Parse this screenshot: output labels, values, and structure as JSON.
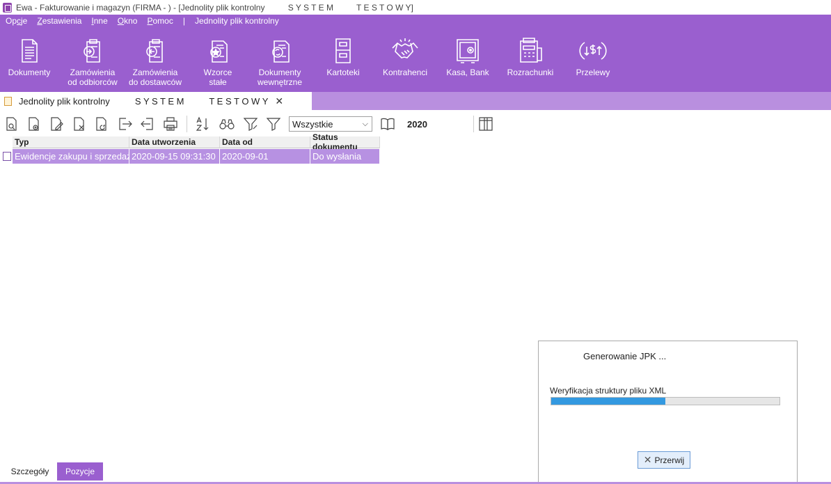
{
  "window": {
    "title": "Ewa - Fakturowanie i magazyn (FIRMA - ) - [Jednolity plik kontrolny          S Y S T E M          T E S T O W Y]"
  },
  "menu": {
    "items": [
      {
        "pre": "Op",
        "u": "c",
        "post": "je"
      },
      {
        "pre": "",
        "u": "Z",
        "post": "estawienia"
      },
      {
        "pre": "",
        "u": "I",
        "post": "nne"
      },
      {
        "pre": "",
        "u": "O",
        "post": "kno"
      },
      {
        "pre": "",
        "u": "P",
        "post": "omoc"
      }
    ],
    "separator": "|",
    "context": "Jednolity plik kontrolny"
  },
  "ribbon": {
    "buttons": [
      {
        "label": "Dokumenty",
        "icon": "document-icon"
      },
      {
        "label": "Zamówienia\nod odbiorców",
        "icon": "order-incoming-icon"
      },
      {
        "label": "Zamówienia\ndo dostawców",
        "icon": "order-outgoing-icon"
      },
      {
        "label": "Wzorce\nstałe",
        "icon": "template-star-icon"
      },
      {
        "label": "Dokumenty\nwewnętrzne",
        "icon": "internal-document-icon"
      },
      {
        "label": "Kartoteki",
        "icon": "cabinet-icon"
      },
      {
        "label": "Kontrahenci",
        "icon": "handshake-icon"
      },
      {
        "label": "Kasa, Bank",
        "icon": "safe-icon"
      },
      {
        "label": "Rozrachunki",
        "icon": "register-icon"
      },
      {
        "label": "Przelewy",
        "icon": "transfer-icon"
      }
    ]
  },
  "doc_tab": {
    "title": "Jednolity plik kontrolny          S Y S T E M          T E S T O W Y",
    "close": "✕"
  },
  "toolbar": {
    "filter_value": "Wszystkie",
    "year": "2020"
  },
  "grid": {
    "columns": [
      "Typ",
      "Data utworzenia",
      "Data od",
      "Status dokumentu"
    ],
    "rows": [
      [
        "Ewidencje zakupu i sprzedaży",
        "2020-09-15 09:31:30",
        "2020-09-01",
        "Do wysłania"
      ]
    ]
  },
  "dialog": {
    "title": "Generowanie JPK ...",
    "message": "Weryfikacja struktury pliku XML",
    "progress": 0.5,
    "cancel_label": "Przerwij"
  },
  "bottom_tabs": {
    "details": "Szczegóły",
    "items": "Pozycje"
  },
  "colors": {
    "accent": "#9a5fcf",
    "tab_strip": "#b98fdf",
    "row_selected": "#b791e2",
    "progress": "#3399e0"
  }
}
